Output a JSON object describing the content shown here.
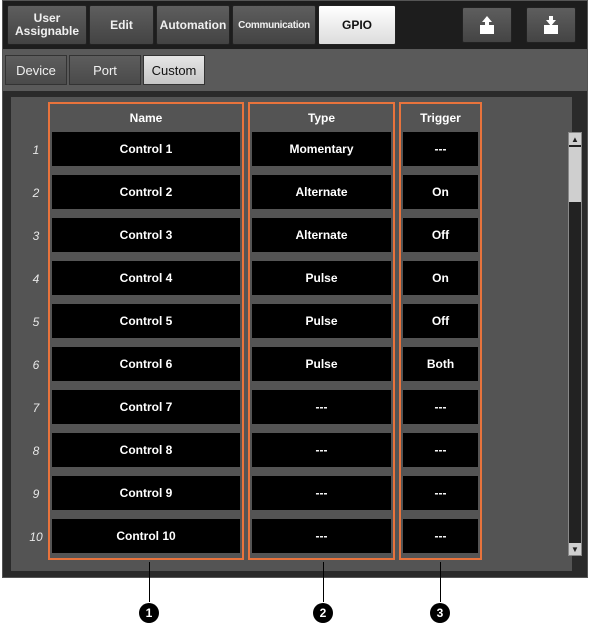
{
  "tabs": [
    {
      "label": "User\nAssignable",
      "active": false
    },
    {
      "label": "Edit",
      "active": false
    },
    {
      "label": "Automation",
      "active": false
    },
    {
      "label": "Communication",
      "active": false
    },
    {
      "label": "GPIO",
      "active": true
    }
  ],
  "buttons": {
    "load_icon": "import-icon",
    "save_icon": "export-icon"
  },
  "subtabs": [
    {
      "label": "Device",
      "active": false
    },
    {
      "label": "Port",
      "active": false
    },
    {
      "label": "Custom",
      "active": true
    }
  ],
  "table": {
    "headers": {
      "name": "Name",
      "type": "Type",
      "trigger": "Trigger"
    },
    "rows": [
      {
        "num": "1",
        "name": "Control 1",
        "type": "Momentary",
        "trigger": "---"
      },
      {
        "num": "2",
        "name": "Control 2",
        "type": "Alternate",
        "trigger": "On"
      },
      {
        "num": "3",
        "name": "Control 3",
        "type": "Alternate",
        "trigger": "Off"
      },
      {
        "num": "4",
        "name": "Control 4",
        "type": "Pulse",
        "trigger": "On"
      },
      {
        "num": "5",
        "name": "Control 5",
        "type": "Pulse",
        "trigger": "Off"
      },
      {
        "num": "6",
        "name": "Control 6",
        "type": "Pulse",
        "trigger": "Both"
      },
      {
        "num": "7",
        "name": "Control 7",
        "type": "---",
        "trigger": "---"
      },
      {
        "num": "8",
        "name": "Control 8",
        "type": "---",
        "trigger": "---"
      },
      {
        "num": "9",
        "name": "Control 9",
        "type": "---",
        "trigger": "---"
      },
      {
        "num": "10",
        "name": "Control 10",
        "type": "---",
        "trigger": "---"
      }
    ]
  },
  "callouts": [
    "1",
    "2",
    "3"
  ],
  "colors": {
    "highlight": "#e8733c",
    "panel": "#2a2a2a",
    "cell": "#000000"
  }
}
